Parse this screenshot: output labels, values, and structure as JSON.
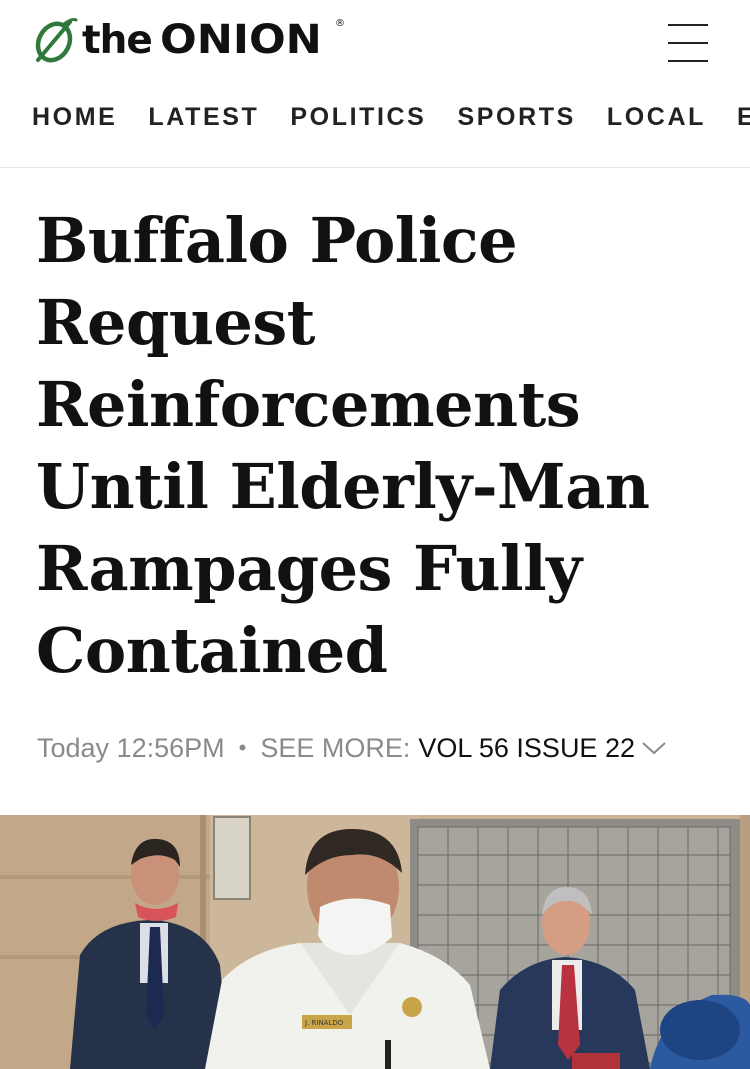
{
  "header": {
    "logo": {
      "the_text": "the",
      "brand_text": "ONION",
      "registered_mark": "®",
      "icon": "onion-logo-icon",
      "brand_color": "#2f7a3a"
    },
    "menu_icon": "hamburger-menu-icon"
  },
  "nav": {
    "items": [
      {
        "label": "HOME"
      },
      {
        "label": "LATEST"
      },
      {
        "label": "POLITICS"
      },
      {
        "label": "SPORTS"
      },
      {
        "label": "LOCAL"
      },
      {
        "label": "ENTER"
      }
    ]
  },
  "article": {
    "headline": "Buffalo Police Request Reinforcements Until Elderly-Man Rampages Fully Contained",
    "timestamp": "Today 12:56PM",
    "separator": "•",
    "see_more_label": "SEE MORE:",
    "issue_label": "VOL 56 ISSUE 22",
    "chevron_icon": "chevron-down-icon",
    "image": {
      "badge_text": "J. RINALDO"
    }
  }
}
